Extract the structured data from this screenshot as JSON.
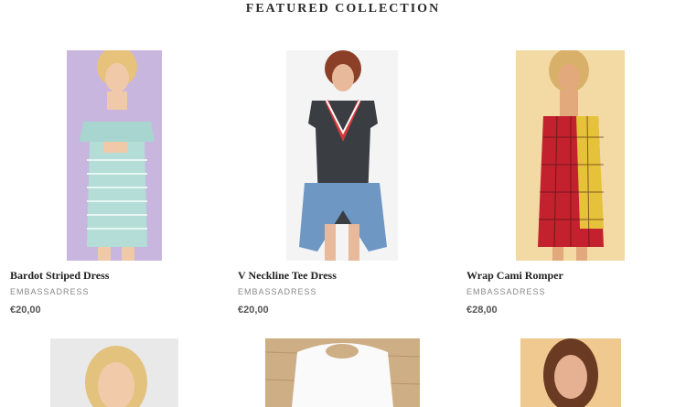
{
  "section": {
    "title": "FEATURED COLLECTION"
  },
  "products": [
    {
      "name": "Bardot Striped Dress",
      "vendor": "EMBASSADRESS",
      "price": "€20,00"
    },
    {
      "name": "V Neckline Tee Dress",
      "vendor": "EMBASSADRESS",
      "price": "€20,00"
    },
    {
      "name": "Wrap Cami Romper",
      "vendor": "EMBASSADRESS",
      "price": "€28,00"
    }
  ],
  "colors": {
    "title": "#2b2b2b",
    "vendor": "#888888",
    "price": "#555555"
  }
}
